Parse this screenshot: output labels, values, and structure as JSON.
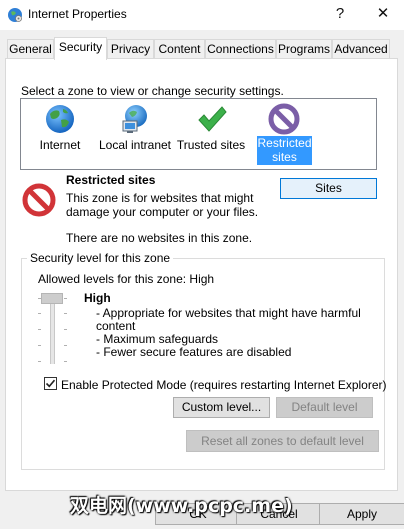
{
  "window": {
    "title": "Internet Properties",
    "help_glyph": "?",
    "close_glyph": "✕"
  },
  "tabs": [
    {
      "label": "General"
    },
    {
      "label": "Security",
      "active": true
    },
    {
      "label": "Privacy"
    },
    {
      "label": "Content"
    },
    {
      "label": "Connections"
    },
    {
      "label": "Programs"
    },
    {
      "label": "Advanced"
    }
  ],
  "zones": {
    "instruction": "Select a zone to view or change security settings.",
    "items": [
      {
        "label": "Internet",
        "icon": "globe-icon"
      },
      {
        "label": "Local intranet",
        "icon": "intranet-icon"
      },
      {
        "label": "Trusted sites",
        "icon": "checkmark-icon"
      },
      {
        "label_line1": "Restricted",
        "label_line2": "sites",
        "icon": "restricted-icon",
        "selected": true
      }
    ]
  },
  "zone_info": {
    "title": "Restricted sites",
    "description_line1": "This zone is for websites that might",
    "description_line2": "damage your computer or your files.",
    "no_sites": "There are no websites in this zone.",
    "sites_button": "Sites"
  },
  "security_level": {
    "legend": "Security level for this zone",
    "allowed_text": "Allowed levels for this zone: High",
    "level": "High",
    "bullets": [
      "- Appropriate for websites that might have harmful",
      "content",
      "- Maximum safeguards",
      "- Fewer secure features are disabled"
    ],
    "protected_mode_label": "Enable Protected Mode (requires restarting Internet Explorer)",
    "protected_mode_checked": true,
    "custom_level_button": "Custom level...",
    "default_level_button": "Default level"
  },
  "reset_all_button": "Reset all zones to default level",
  "footer": {
    "ok": "OK",
    "cancel": "Cancel",
    "apply": "Apply"
  },
  "watermark": "双电网(www.pcpc.me)",
  "colors": {
    "selection": "#3399ff",
    "focus_border": "#0078d7",
    "restricted_red": "#d13438",
    "check_green": "#3cb04a"
  }
}
